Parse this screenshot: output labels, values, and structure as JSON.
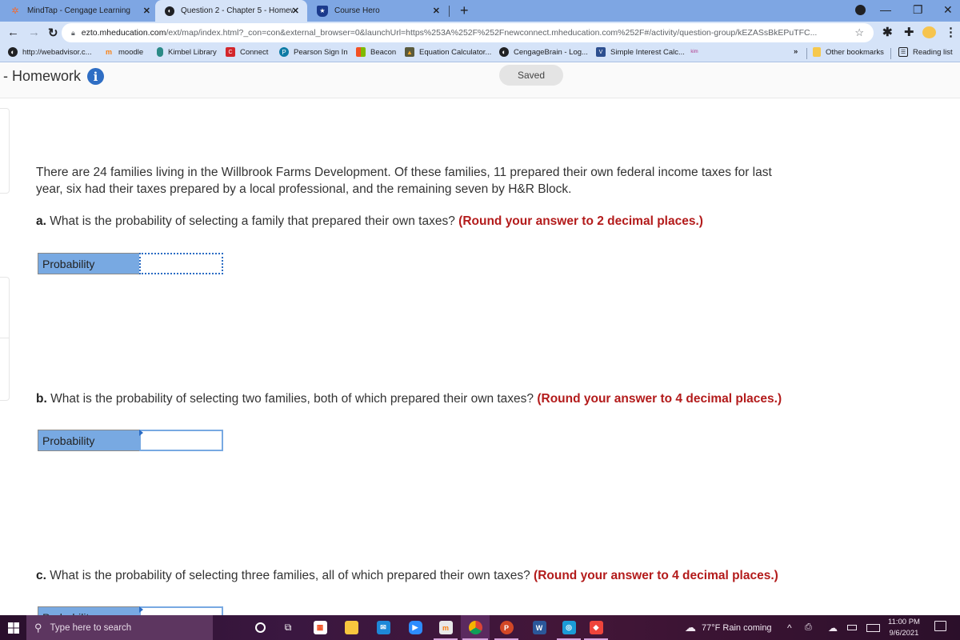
{
  "browser": {
    "tabs": [
      {
        "label": "MindTap - Cengage Learning",
        "icon": "mindtap-icon",
        "active": false
      },
      {
        "label": "Question 2 - Chapter 5 - Homew",
        "icon": "globe-icon",
        "active": true
      },
      {
        "label": "Course Hero",
        "icon": "coursehero-shield-icon",
        "active": false
      }
    ],
    "new_tab": "+",
    "window_controls": {
      "minimize": "—",
      "restore": "❐",
      "close": "✕"
    },
    "address": {
      "host": "ezto.mheducation.com",
      "path": "/ext/map/index.html?_con=con&external_browser=0&launchUrl=https%253A%252F%252Fnewconnect.mheducation.com%252F#/activity/question-group/kEZASsBkEPuTFC..."
    },
    "bookmarks": [
      {
        "label": "http://webadvisor.c...",
        "icon": "globe-icon"
      },
      {
        "label": "moodle",
        "icon": "moodle-icon"
      },
      {
        "label": "Kimbel Library",
        "icon": "library-icon"
      },
      {
        "label": "Connect",
        "icon": "connect-icon"
      },
      {
        "label": "Pearson Sign In",
        "icon": "pearson-icon"
      },
      {
        "label": "Beacon",
        "icon": "windows-grid-icon"
      },
      {
        "label": "Equation Calculator...",
        "icon": "calculator-icon"
      },
      {
        "label": "CengageBrain - Log...",
        "icon": "globe-icon"
      },
      {
        "label": "Simple Interest Calc...",
        "icon": "calc-site-icon"
      },
      {
        "label": "",
        "icon": "kim-icon"
      }
    ],
    "more_bookmarks": "»",
    "other_bookmarks": "Other bookmarks",
    "reading_list": "Reading list"
  },
  "header": {
    "title": "- Homework",
    "status": "Saved"
  },
  "question": {
    "intro_line1": "There are 24 families living in the Willbrook Farms Development. Of these families, 11 prepared their own federal income taxes for last",
    "intro_line2": "year, six had their taxes prepared by a local professional, and the remaining seven by H&R Block.",
    "parts": [
      {
        "letter": "a.",
        "text": " What is the probability of selecting a family that prepared their own taxes? ",
        "hint": "(Round your answer to 2 decimal places.)",
        "answer_label": "Probability",
        "answer_value": ""
      },
      {
        "letter": "b.",
        "text": " What is the probability of selecting two families, both of which prepared their own taxes? ",
        "hint": "(Round your answer to 4 decimal places.)",
        "answer_label": "Probability",
        "answer_value": ""
      },
      {
        "letter": "c.",
        "text": " What is the probability of selecting three families, all of which prepared their own taxes? ",
        "hint": "(Round your answer to 4 decimal places.)",
        "answer_label": "Probability",
        "answer_value": ""
      }
    ]
  },
  "taskbar": {
    "search_placeholder": "Type here to search",
    "weather": "77°F  Rain coming",
    "time": "11:00 PM",
    "date": "9/6/2021"
  },
  "colors": {
    "accent_blue": "#78a9e2",
    "hint_red": "#b31b1b",
    "info_blue": "#2f6ec4"
  }
}
